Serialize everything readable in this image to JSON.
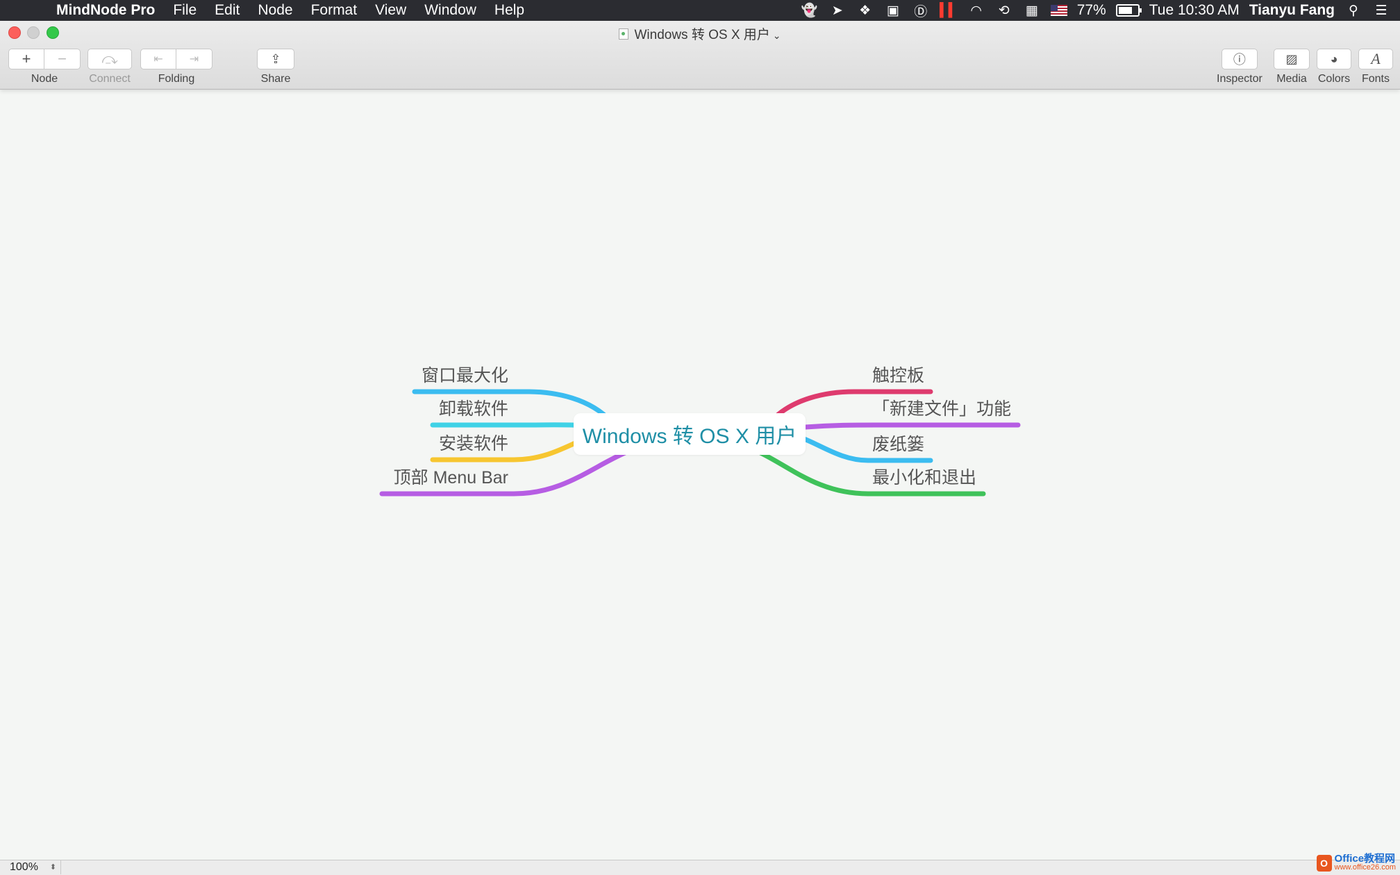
{
  "menubar": {
    "app_name": "MindNode Pro",
    "menus": [
      "File",
      "Edit",
      "Node",
      "Format",
      "View",
      "Window",
      "Help"
    ],
    "battery_percent": "77%",
    "clock": "Tue 10:30 AM",
    "user": "Tianyu Fang"
  },
  "window": {
    "title": "Windows 转 OS X 用户"
  },
  "toolbar": {
    "node_label": "Node",
    "connect_label": "Connect",
    "folding_label": "Folding",
    "share_label": "Share",
    "inspector_label": "Inspector",
    "media_label": "Media",
    "colors_label": "Colors",
    "fonts_label": "Fonts",
    "add_glyph": "+",
    "remove_glyph": "−",
    "fonts_glyph": "A"
  },
  "mindmap": {
    "central": "Windows 转 OS X 用户",
    "left_branches": [
      {
        "label": "窗口最大化",
        "color": "#3bbcf0"
      },
      {
        "label": "卸载软件",
        "color": "#3fd2e6"
      },
      {
        "label": "安装软件",
        "color": "#f7c630"
      },
      {
        "label": "顶部 Menu Bar",
        "color": "#b65de3"
      }
    ],
    "right_branches": [
      {
        "label": "触控板",
        "color": "#de3b6e"
      },
      {
        "label": "「新建文件」功能",
        "color": "#b65de3"
      },
      {
        "label": "废纸篓",
        "color": "#3bbcf0"
      },
      {
        "label": "最小化和退出",
        "color": "#3fc25a"
      }
    ]
  },
  "statusbar": {
    "zoom": "100%"
  },
  "watermark": {
    "title": "Office教程网",
    "url": "www.office26.com"
  }
}
